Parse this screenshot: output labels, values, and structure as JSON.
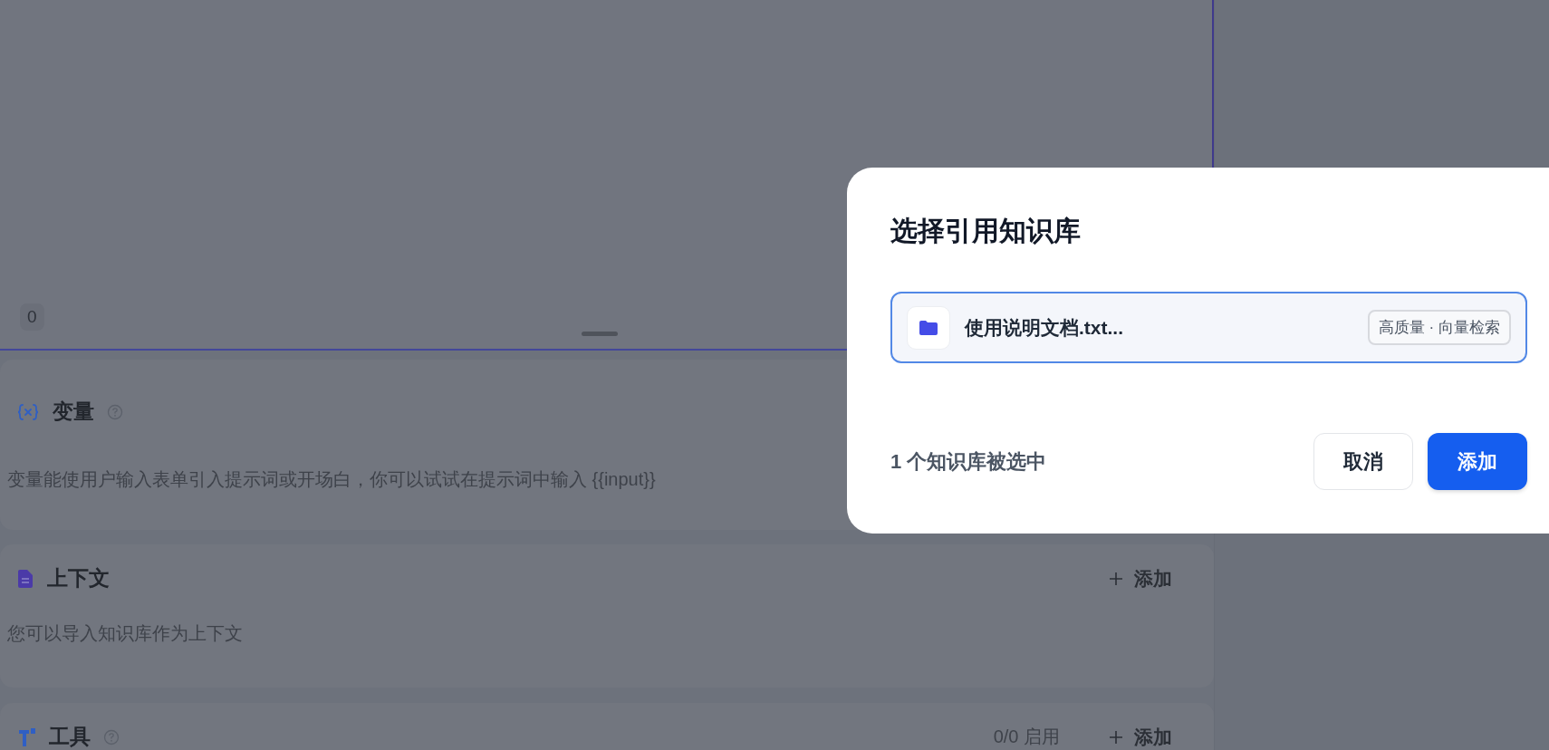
{
  "prompt_editor": {
    "char_count": "0"
  },
  "sections": [
    {
      "kind": "variables",
      "title": "变量",
      "help": true,
      "description": "变量能使用户输入表单引入提示词或开场白，你可以试试在提示词中输入 {{input}}"
    },
    {
      "kind": "context",
      "title": "上下文",
      "help": false,
      "add_label": "添加",
      "description": "您可以导入知识库作为上下文"
    },
    {
      "kind": "tools",
      "title": "工具",
      "help": true,
      "status": "0/0 启用",
      "add_label": "添加"
    }
  ],
  "dialog": {
    "title": "选择引用知识库",
    "datasets": [
      {
        "name": "使用说明文档.txt...",
        "tag": "高质量 · 向量检索",
        "selected": true
      }
    ],
    "selection_summary": "1 个知识库被选中",
    "buttons": [
      {
        "label": "取消",
        "kind": "secondary"
      },
      {
        "label": "添加",
        "kind": "primary"
      }
    ]
  }
}
